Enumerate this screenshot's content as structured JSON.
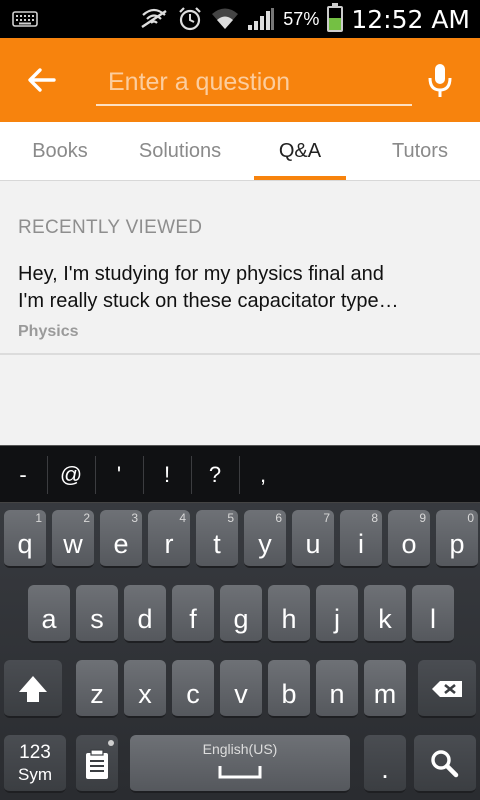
{
  "status_bar": {
    "battery_percent": "57%",
    "time": "12:52 AM",
    "icons": [
      "keyboard-icon",
      "signal-blocked-icon",
      "alarm-icon",
      "wifi-icon",
      "cellular-signal-icon",
      "battery-icon"
    ]
  },
  "header": {
    "search_placeholder": "Enter a question",
    "back_icon": "arrow-left-icon",
    "mic_icon": "microphone-icon",
    "accent_color": "#f7830d"
  },
  "tabs": [
    {
      "label": "Books",
      "active": false
    },
    {
      "label": "Solutions",
      "active": false
    },
    {
      "label": "Q&A",
      "active": true
    },
    {
      "label": "Tutors",
      "active": false
    }
  ],
  "recently_viewed": {
    "title": "RECENTLY VIEWED",
    "items": [
      {
        "line1": "Hey,  I'm studying for my physics final and",
        "line2": "I'm really stuck on these capacitator type…",
        "subject": "Physics"
      }
    ]
  },
  "keyboard": {
    "suggestions": [
      "-",
      "@",
      "'",
      "!",
      "?",
      ","
    ],
    "row1": [
      {
        "ch": "q",
        "num": "1"
      },
      {
        "ch": "w",
        "num": "2"
      },
      {
        "ch": "e",
        "num": "3"
      },
      {
        "ch": "r",
        "num": "4"
      },
      {
        "ch": "t",
        "num": "5"
      },
      {
        "ch": "y",
        "num": "6"
      },
      {
        "ch": "u",
        "num": "7"
      },
      {
        "ch": "i",
        "num": "8"
      },
      {
        "ch": "o",
        "num": "9"
      },
      {
        "ch": "p",
        "num": "0"
      }
    ],
    "row2": [
      "a",
      "s",
      "d",
      "f",
      "g",
      "h",
      "j",
      "k",
      "l"
    ],
    "row3": [
      "z",
      "x",
      "c",
      "v",
      "b",
      "n",
      "m"
    ],
    "sym_label_top": "123",
    "sym_label_bottom": "Sym",
    "space_label": "English(US)",
    "period": ".",
    "shift_icon": "shift-arrow-icon",
    "backspace_icon": "backspace-icon",
    "clipboard_icon": "clipboard-icon",
    "search_key_icon": "search-icon"
  }
}
